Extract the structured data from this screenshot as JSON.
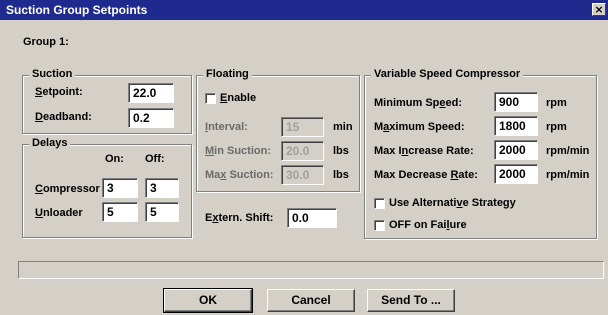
{
  "window": {
    "title": "Suction Group Setpoints",
    "close_glyph": "×"
  },
  "group_label": "Group 1:",
  "suction": {
    "title": "Suction",
    "setpoint": {
      "label": "Setpoint:",
      "value": "22.0"
    },
    "deadband": {
      "label": "Deadband:",
      "value": "0.2"
    }
  },
  "delays": {
    "title": "Delays",
    "on_header": "On:",
    "off_header": "Off:",
    "compressor": {
      "label": "Compressor",
      "on": "3",
      "off": "3"
    },
    "unloader": {
      "label": "Unloader",
      "on": "5",
      "off": "5"
    }
  },
  "floating": {
    "title": "Floating",
    "enable_label": "Enable",
    "enable_checked": false,
    "interval": {
      "label": "Interval:",
      "value": "15",
      "unit": "min"
    },
    "min_suction": {
      "label": "Min Suction:",
      "value": "20.0",
      "unit": "lbs"
    },
    "max_suction": {
      "label": "Max Suction:",
      "value": "30.0",
      "unit": "lbs"
    }
  },
  "extern_shift": {
    "label": "Extern. Shift:",
    "value": "0.0"
  },
  "vsc": {
    "title": "Variable Speed Compressor",
    "min_speed": {
      "label": "Minimum Speed:",
      "value": "900",
      "unit": "rpm"
    },
    "max_speed": {
      "label": "Maximum Speed:",
      "value": "1800",
      "unit": "rpm"
    },
    "max_increase": {
      "label": "Max Increase Rate:",
      "value": "2000",
      "unit": "rpm/min"
    },
    "max_decrease": {
      "label": "Max Decrease Rate:",
      "value": "2000",
      "unit": "rpm/min"
    },
    "alt_strategy_label": "Use Alternative Strategy",
    "alt_strategy_checked": false,
    "off_on_failure_label": "OFF on Failure",
    "off_on_failure_checked": false
  },
  "buttons": {
    "ok": "OK",
    "cancel": "Cancel",
    "send_to": "Send To ..."
  }
}
